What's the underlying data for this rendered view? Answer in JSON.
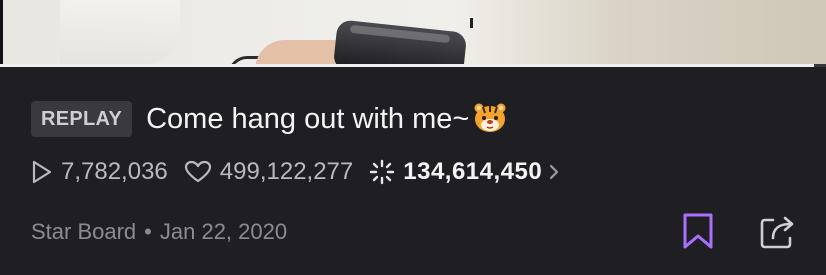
{
  "video": {
    "progress_fraction": 0.985
  },
  "stream": {
    "badge": "REPLAY",
    "title": "Come hang out with me~",
    "title_emoji": "tiger-face-emoji"
  },
  "stats": {
    "plays": "7,782,036",
    "likes": "499,122,277",
    "sparkles": "134,614,450"
  },
  "meta": {
    "board": "Star Board",
    "separator": "•",
    "date": "Jan 22, 2020"
  },
  "colors": {
    "background": "#1f1f23",
    "bookmark_accent": "#a970ff",
    "muted_text": "#8b8b91"
  },
  "icons": [
    "play-icon",
    "heart-icon",
    "sparkle-icon",
    "chevron-right-icon",
    "bookmark-icon",
    "share-icon"
  ]
}
